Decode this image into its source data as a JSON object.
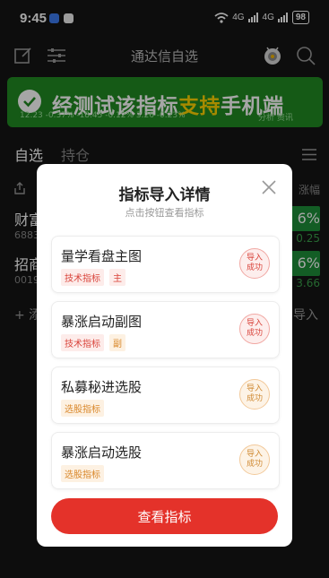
{
  "status_bar": {
    "time": "9:45",
    "signal1": "4G",
    "signal2": "4G",
    "battery": "98"
  },
  "header": {
    "title": "通达信自选"
  },
  "banner": {
    "text_before": "经测试该指标",
    "text_highlight": "支持",
    "text_after": "手机端",
    "sub_right": "分析  资讯",
    "colors": {
      "background": "#218a22",
      "highlight": "#ffd400"
    }
  },
  "tickers": {
    "line1": "上证指数   深证成指   北证50",
    "line2": "12.23 -0.37%   -18.45 -0.12%   3.26 -0.23%"
  },
  "tabs": [
    {
      "label": "自选"
    },
    {
      "label": "持仓"
    }
  ],
  "background_list": {
    "col_right": "涨幅",
    "rows": [
      {
        "name": "财富",
        "code": "6883",
        "pill": "6%",
        "value": "0.25"
      },
      {
        "name": "招商",
        "code": "0019",
        "pill": "6%",
        "value": "3.66"
      }
    ],
    "add_text": "+ 添",
    "import_text": "导入"
  },
  "modal": {
    "title": "指标导入详情",
    "subtitle": "点击按钮查看指标",
    "button_label": "查看指标",
    "button_color": "#e4322a",
    "items": [
      {
        "name": "量学看盘主图",
        "tags": [
          "技术指标",
          "主"
        ],
        "status_line1": "导入",
        "status_line2": "成功"
      },
      {
        "name": "暴涨启动副图",
        "tags": [
          "技术指标",
          "副"
        ],
        "status_line1": "导入",
        "status_line2": "成功"
      },
      {
        "name": "私募秘进选股",
        "tags": [
          "选股指标"
        ],
        "status_line1": "导入",
        "status_line2": "成功"
      },
      {
        "name": "暴涨启动选股",
        "tags": [
          "选股指标"
        ],
        "status_line1": "导入",
        "status_line2": "成功"
      }
    ]
  }
}
